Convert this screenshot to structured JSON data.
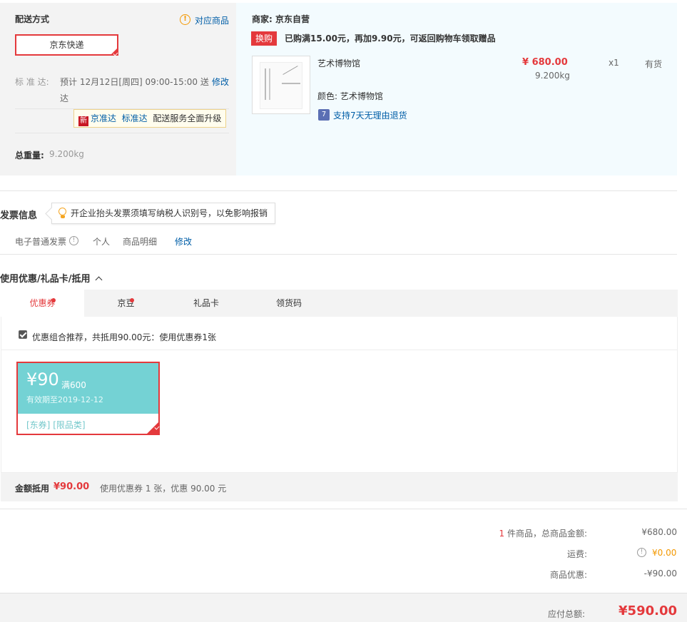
{
  "shipping": {
    "title": "配送方式",
    "related_link": "对应商品",
    "method": "京东快递",
    "std_label": "标 准 达:",
    "std_text_line1": "预计 12月12日[周四] 09:00-15:00 送",
    "std_text_line2": "达",
    "modify": "修改",
    "tip_new": "新",
    "tip_link1": "京准达",
    "tip_link2": "标准达",
    "tip_text": "配送服务全面升级",
    "weight_label": "总重量:",
    "weight_value": "9.200kg"
  },
  "merchant": {
    "label": "商家:",
    "name": "京东自营",
    "swap_tag": "换购",
    "promo": "已购满15.00元，再加9.90元，可返回购物车领取赠品",
    "product_name": "艺术博物馆",
    "price": "¥ 680.00",
    "weight": "9.200kg",
    "qty": "x1",
    "stock": "有货",
    "color_label": "颜色:",
    "color_value": "艺术博物馆",
    "return_badge": "7",
    "return_text": "支持7天无理由退货"
  },
  "invoice": {
    "title": "发票信息",
    "tip": "开企业抬头发票须填写纳税人识别号，以免影响报销",
    "type": "电子普通发票",
    "owner": "个人",
    "content": "商品明细",
    "modify": "修改"
  },
  "discount": {
    "title": "使用优惠/礼品卡/抵用",
    "tabs": [
      "优惠券",
      "京豆",
      "礼品卡",
      "领货码"
    ],
    "combo_text": "优惠组合推荐，共抵用90.00元：使用优惠券1张",
    "coupon": {
      "amount": "¥90",
      "condition": "满600",
      "expiry": "有效期至2019-12-12",
      "tag1": "[东券]",
      "tag2": "[限品类]"
    },
    "summary_label": "金额抵用",
    "summary_amount": "¥90.00",
    "summary_text": "使用优惠券 1 张，优惠 90.00 元"
  },
  "totals": {
    "count": "1",
    "count_text": "件商品，总商品金额:",
    "goods_amount": "¥680.00",
    "freight_label": "运费:",
    "freight_amount": "¥0.00",
    "discount_label": "商品优惠:",
    "discount_amount": "-¥90.00",
    "payable_label": "应付总额:",
    "payable_amount": "¥590.00"
  },
  "colors": {
    "accent_red": "#e4393c",
    "link_blue": "#005ea7",
    "coupon_teal": "#74d2d4",
    "warn_orange": "#f39800"
  }
}
